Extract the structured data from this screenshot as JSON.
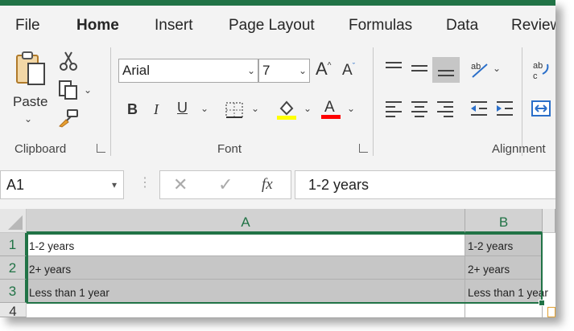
{
  "ribbon_tabs": [
    {
      "label": "File"
    },
    {
      "label": "Home"
    },
    {
      "label": "Insert"
    },
    {
      "label": "Page Layout"
    },
    {
      "label": "Formulas"
    },
    {
      "label": "Data"
    },
    {
      "label": "Review"
    }
  ],
  "active_tab": "Home",
  "clipboard": {
    "paste_label": "Paste",
    "group_label": "Clipboard"
  },
  "font": {
    "name": "Arial",
    "size": "7",
    "group_label": "Font",
    "highlight_color": "#ffff00",
    "font_color": "#ff0000"
  },
  "alignment": {
    "group_label": "Alignment"
  },
  "formula_bar": {
    "name_box": "A1",
    "fx": "fx",
    "value": "1-2 years"
  },
  "sheet": {
    "columns": [
      "A",
      "B"
    ],
    "rows": [
      {
        "num": "1",
        "a": "1-2 years",
        "b": "1-2 years"
      },
      {
        "num": "2",
        "a": "2+ years",
        "b": "2+ years"
      },
      {
        "num": "3",
        "a": "Less than 1 year",
        "b": "Less than 1 year"
      },
      {
        "num": "4",
        "a": "",
        "b": ""
      }
    ]
  },
  "colors": {
    "accent": "#217346"
  }
}
